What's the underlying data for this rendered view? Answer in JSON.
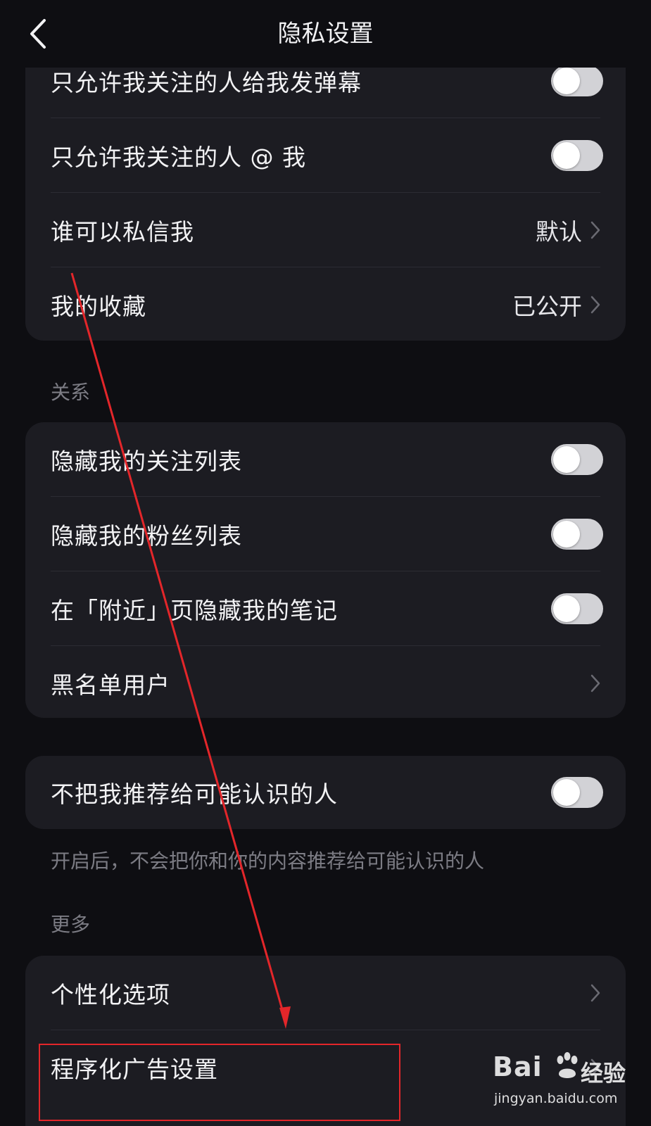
{
  "header": {
    "title": "隐私设置",
    "back_icon": "chevron-left-icon"
  },
  "card1": {
    "rows": [
      {
        "label": "只允许我关注的人给我发弹幕",
        "toggle": false
      },
      {
        "label": "只允许我关注的人 @ 我",
        "toggle": false
      },
      {
        "label": "谁可以私信我",
        "value": "默认"
      },
      {
        "label": "我的收藏",
        "value": "已公开"
      }
    ]
  },
  "sections": {
    "relation": "关系",
    "more": "更多"
  },
  "card2": {
    "rows": [
      {
        "label": "隐藏我的关注列表",
        "toggle": false
      },
      {
        "label": "隐藏我的粉丝列表",
        "toggle": false
      },
      {
        "label": "在「附近」页隐藏我的笔记",
        "toggle": false
      },
      {
        "label": "黑名单用户"
      }
    ]
  },
  "card3": {
    "rows": [
      {
        "label": "不把我推荐给可能认识的人",
        "toggle": false
      }
    ],
    "hint": "开启后，不会把你和你的内容推荐给可能认识的人"
  },
  "card4": {
    "rows": [
      {
        "label": "个性化选项"
      },
      {
        "label": "程序化广告设置"
      }
    ]
  },
  "watermark": {
    "logo": "Bai",
    "logo_suffix": "经验",
    "url": "jingyan.baidu.com"
  },
  "colors": {
    "background": "#0e0e12",
    "card": "#1c1c22",
    "annotation": "#e3262a",
    "toggle_off": "#d2d2d6"
  }
}
